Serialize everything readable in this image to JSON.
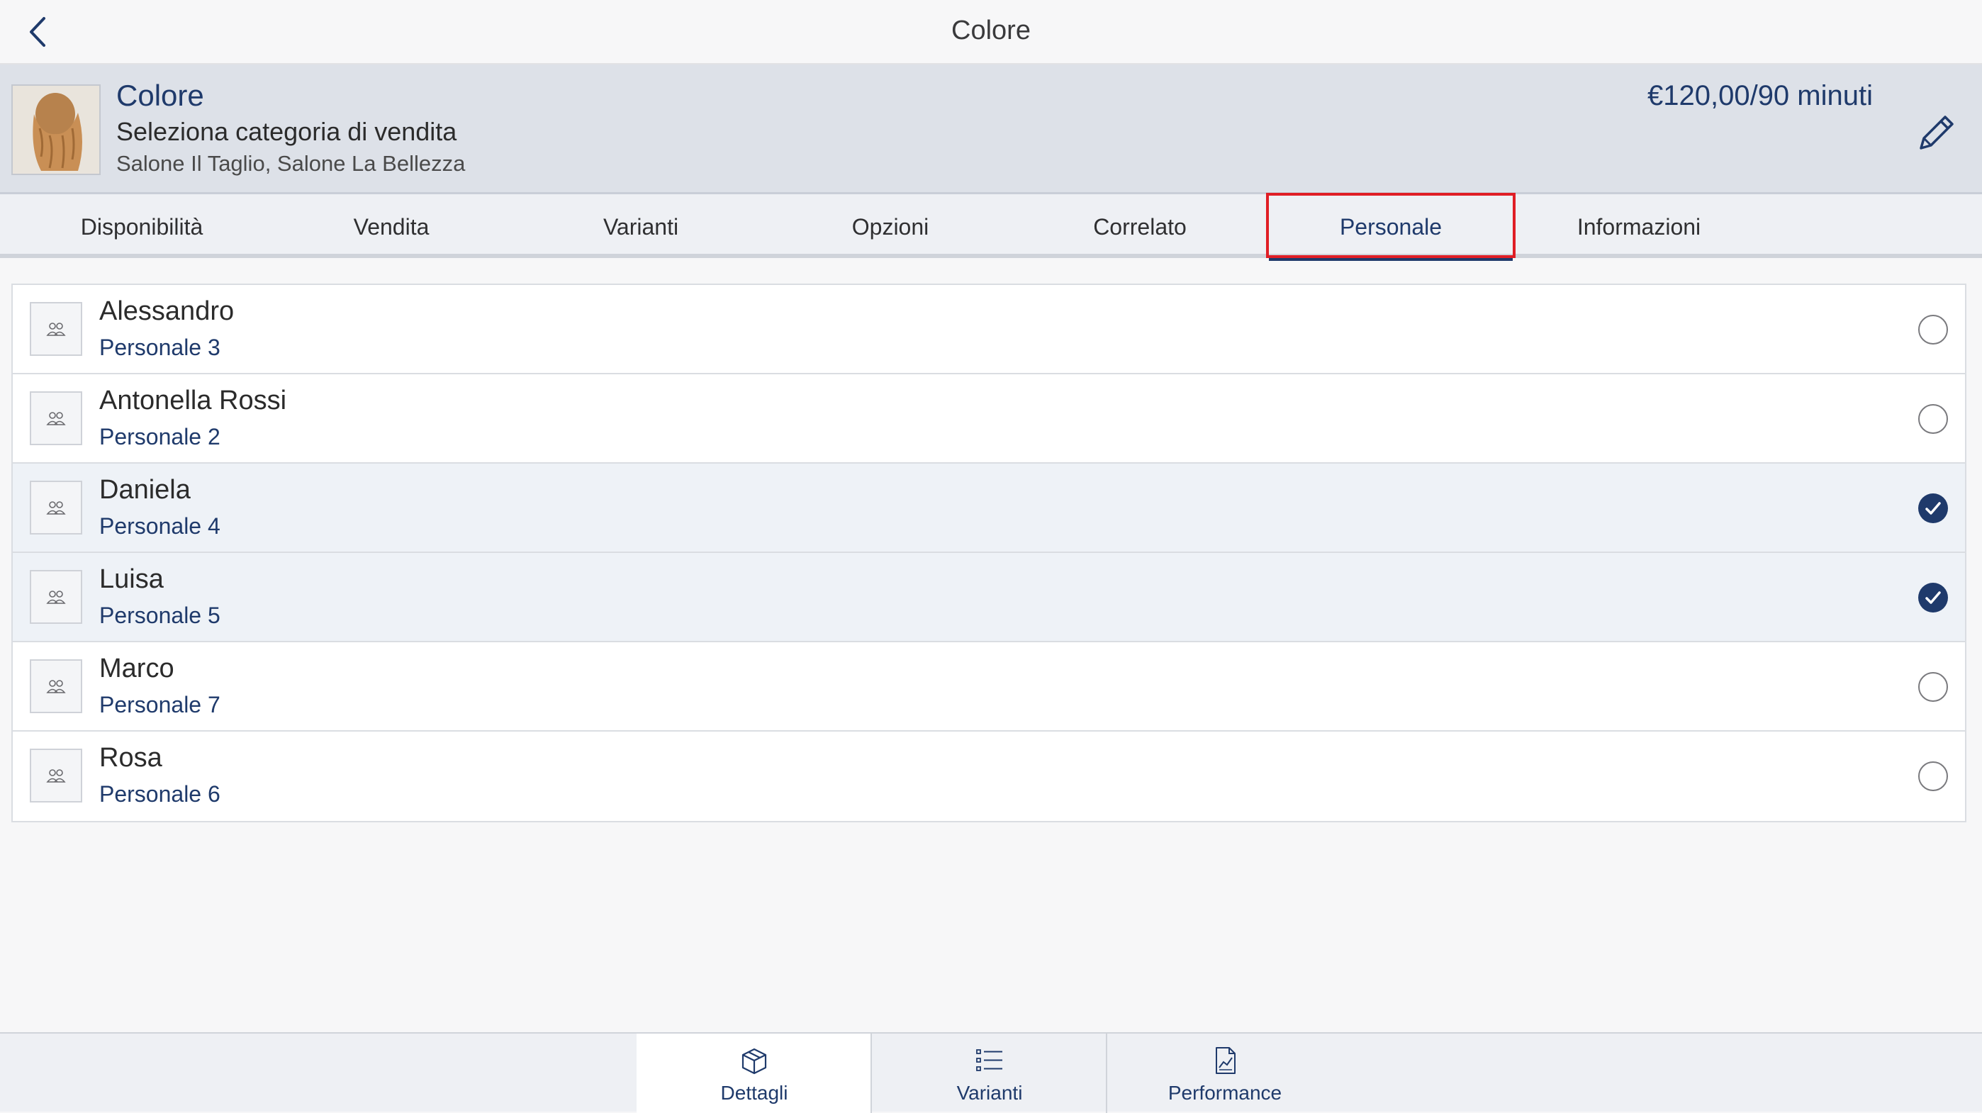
{
  "topbar": {
    "title": "Colore",
    "back_icon": "chevron-left-icon"
  },
  "header": {
    "name": "Colore",
    "category": "Seleziona categoria di vendita",
    "locations": "Salone Il Taglio, Salone La Bellezza",
    "price": "€120,00/90 minuti",
    "edit_icon": "pencil-icon"
  },
  "tabs": [
    {
      "label": "Disponibilità"
    },
    {
      "label": "Vendita"
    },
    {
      "label": "Varianti"
    },
    {
      "label": "Opzioni"
    },
    {
      "label": "Correlato"
    },
    {
      "label": "Personale",
      "active": true
    },
    {
      "label": "Informazioni"
    }
  ],
  "staff": [
    {
      "name": "Alessandro",
      "role": "Personale 3",
      "selected": false
    },
    {
      "name": "Antonella Rossi",
      "role": "Personale 2",
      "selected": false
    },
    {
      "name": "Daniela",
      "role": "Personale 4",
      "selected": true
    },
    {
      "name": "Luisa",
      "role": "Personale 5",
      "selected": true
    },
    {
      "name": "Marco",
      "role": "Personale 7",
      "selected": false
    },
    {
      "name": "Rosa",
      "role": "Personale 6",
      "selected": false
    }
  ],
  "bottom_tabs": [
    {
      "label": "Dettagli",
      "icon": "box-icon",
      "active": true
    },
    {
      "label": "Varianti",
      "icon": "list-icon",
      "active": false
    },
    {
      "label": "Performance",
      "icon": "chart-document-icon",
      "active": false
    }
  ],
  "colors": {
    "accent": "#1f3a6b",
    "highlight": "#e01e25",
    "header_bg": "#dde1e8"
  }
}
